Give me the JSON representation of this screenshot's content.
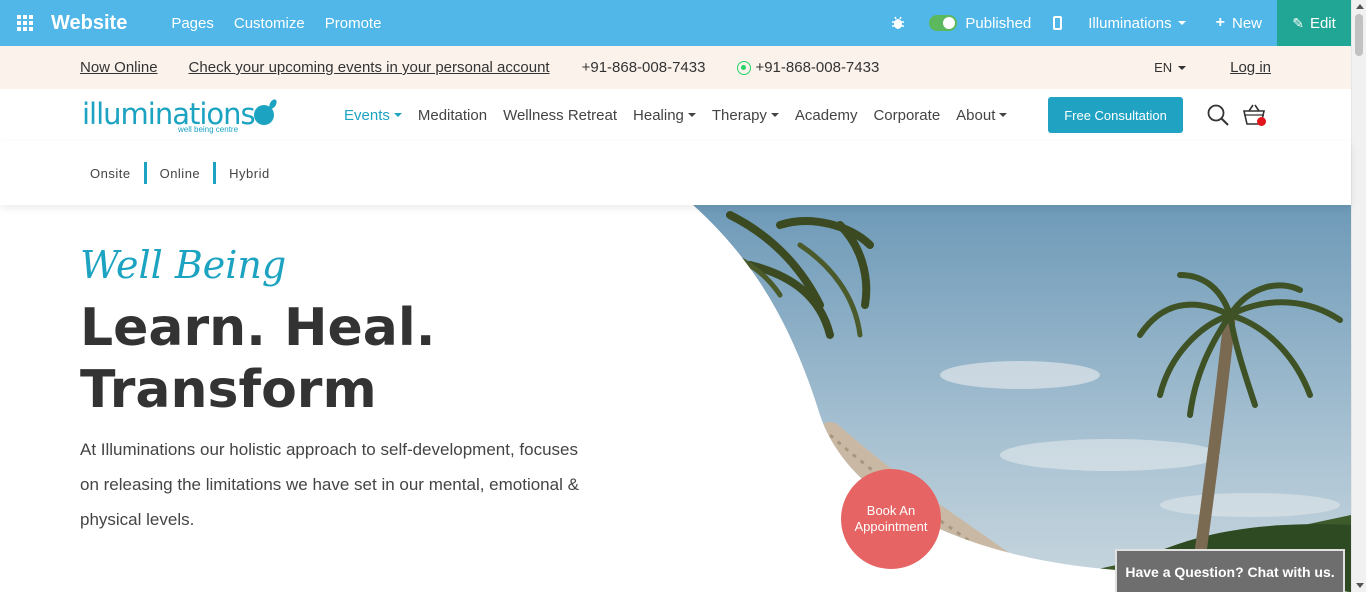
{
  "admin": {
    "title": "Website",
    "nav": [
      "Pages",
      "Customize",
      "Promote"
    ],
    "published_label": "Published",
    "site_name": "Illuminations",
    "new_label": "New",
    "edit_label": "Edit",
    "bar_color": "#50b7e8",
    "edit_color": "#21a696"
  },
  "info_bar": {
    "now_online": "Now Online",
    "events_link": "Check your upcoming events in your personal account",
    "phone": "+91-868-008-7433",
    "whatsapp_phone": "+91-868-008-7433",
    "language": "EN",
    "login": "Log in"
  },
  "brand": {
    "logo_text": "illuminations",
    "logo_sub": "well being centre",
    "accent": "#1ba3c1"
  },
  "nav": {
    "items": [
      {
        "label": "Events",
        "dropdown": true,
        "active": true
      },
      {
        "label": "Meditation",
        "dropdown": false
      },
      {
        "label": "Wellness Retreat",
        "dropdown": false
      },
      {
        "label": "Healing",
        "dropdown": true
      },
      {
        "label": "Therapy",
        "dropdown": true
      },
      {
        "label": "Academy",
        "dropdown": false
      },
      {
        "label": "Corporate",
        "dropdown": false
      },
      {
        "label": "About",
        "dropdown": true
      }
    ],
    "consult_button": "Free Consultation"
  },
  "filters": [
    "Onsite",
    "Online",
    "Hybrid"
  ],
  "hero": {
    "tagline": "Well Being",
    "headline_line1": "Learn. Heal.",
    "headline_line2": "Transform",
    "description": "At Illuminations our holistic approach to self-development, focuses on releasing the limitations we have set in our mental, emotional & physical levels.",
    "book_button": "Book An Appointment",
    "book_color": "#e66464"
  },
  "chat": {
    "label": "Have a Question? Chat with us."
  }
}
